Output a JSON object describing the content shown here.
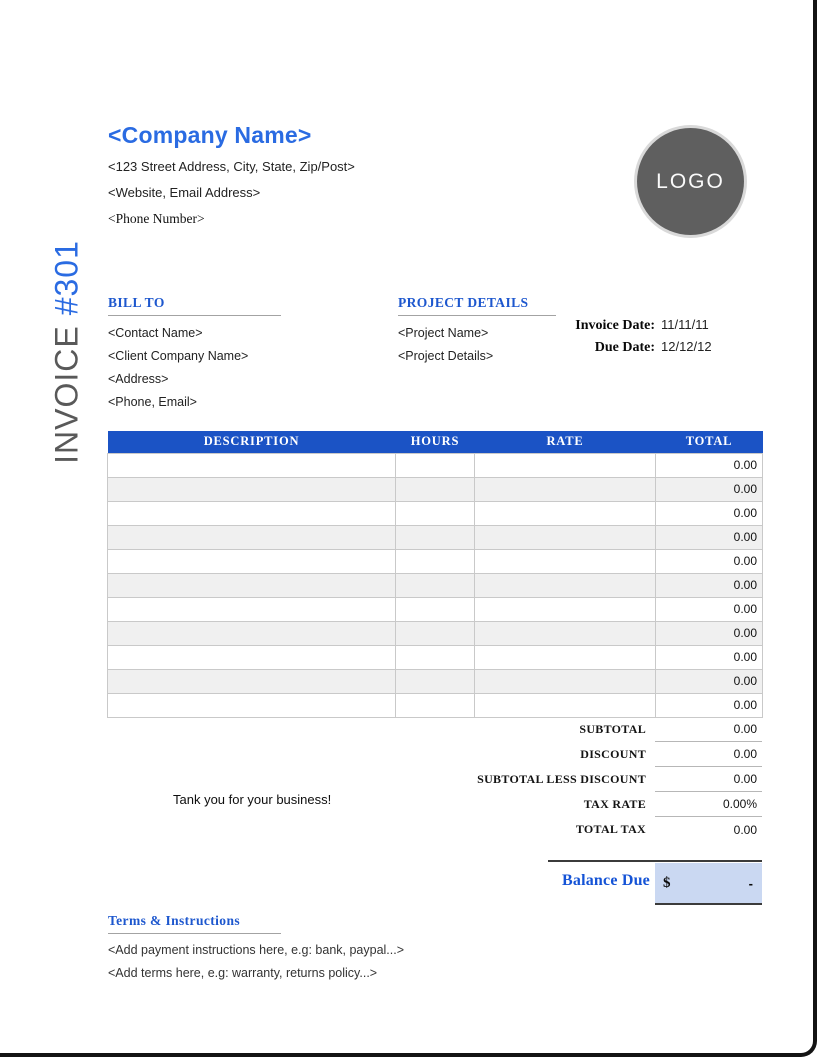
{
  "company": {
    "name": "<Company Name>",
    "address": "<123 Street Address, City, State, Zip/Post>",
    "website": "<Website, Email Address>",
    "phone": "<Phone Number>"
  },
  "logo": {
    "text": "LOGO"
  },
  "banner": {
    "label": "INVOICE",
    "number": "#301"
  },
  "bill_to": {
    "title": "BILL TO",
    "lines": [
      "<Contact Name>",
      "<Client Company Name>",
      "<Address>",
      "<Phone, Email>"
    ]
  },
  "project": {
    "title": "PROJECT DETAILS",
    "lines": [
      "<Project Name>",
      "<Project Details>"
    ]
  },
  "dates": {
    "invoice_date_label": "Invoice Date:",
    "invoice_date": "11/11/11",
    "due_date_label": "Due Date:",
    "due_date": "12/12/12"
  },
  "table": {
    "headers": [
      "DESCRIPTION",
      "HOURS",
      "RATE",
      "TOTAL"
    ],
    "rows": [
      {
        "description": "",
        "hours": "",
        "rate": "",
        "total": "0.00"
      },
      {
        "description": "",
        "hours": "",
        "rate": "",
        "total": "0.00"
      },
      {
        "description": "",
        "hours": "",
        "rate": "",
        "total": "0.00"
      },
      {
        "description": "",
        "hours": "",
        "rate": "",
        "total": "0.00"
      },
      {
        "description": "",
        "hours": "",
        "rate": "",
        "total": "0.00"
      },
      {
        "description": "",
        "hours": "",
        "rate": "",
        "total": "0.00"
      },
      {
        "description": "",
        "hours": "",
        "rate": "",
        "total": "0.00"
      },
      {
        "description": "",
        "hours": "",
        "rate": "",
        "total": "0.00"
      },
      {
        "description": "",
        "hours": "",
        "rate": "",
        "total": "0.00"
      },
      {
        "description": "",
        "hours": "",
        "rate": "",
        "total": "0.00"
      },
      {
        "description": "",
        "hours": "",
        "rate": "",
        "total": "0.00"
      }
    ]
  },
  "summary": {
    "rows": [
      {
        "label": "SUBTOTAL",
        "value": "0.00"
      },
      {
        "label": "DISCOUNT",
        "value": "0.00"
      },
      {
        "label": "SUBTOTAL LESS DISCOUNT",
        "value": "0.00"
      },
      {
        "label": "TAX RATE",
        "value": "0.00%"
      },
      {
        "label": "TOTAL TAX",
        "value": "0.00"
      }
    ]
  },
  "notes": {
    "thank_you": "Tank you for your business!"
  },
  "balance": {
    "label": "Balance Due",
    "currency": "$",
    "amount": "-"
  },
  "terms": {
    "title": "Terms & Instructions",
    "lines": [
      "<Add payment instructions here, e.g: bank, paypal...>",
      "<Add terms here, e.g: warranty, returns policy...>"
    ]
  },
  "colors": {
    "accent_blue": "#1D57CE",
    "company_blue": "#2A6BE2",
    "table_header_bg": "#1B53C5",
    "row_alt": "#F0F0F0",
    "balance_box_fill": "#CAD8F2",
    "logo_gray": "#5F5F5F",
    "invoice_gray": "#595959"
  }
}
